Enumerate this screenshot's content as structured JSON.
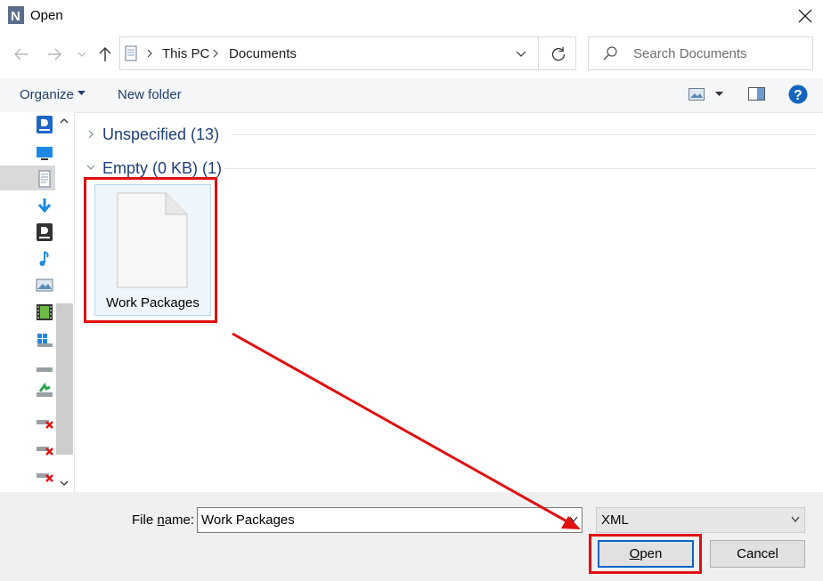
{
  "window": {
    "title": "Open",
    "app_icon": "N"
  },
  "address": {
    "crumbs": [
      "This PC",
      "Documents"
    ]
  },
  "search": {
    "placeholder": "Search Documents"
  },
  "toolbar": {
    "organize": "Organize",
    "new_folder": "New folder",
    "help": "?"
  },
  "groups": [
    {
      "label": "Unspecified (13)",
      "expanded": false
    },
    {
      "label": "Empty (0 KB) (1)",
      "expanded": true
    }
  ],
  "files": [
    {
      "name": "Work Packages"
    }
  ],
  "bottom": {
    "file_name_label_pre": "File ",
    "file_name_label_ul": "n",
    "file_name_label_post": "ame:",
    "file_name_value": "Work Packages",
    "file_type": "XML",
    "open_label": "Open",
    "open_label_ul": "O",
    "open_label_rest": "pen",
    "cancel_label": "Cancel"
  },
  "annotations": {
    "highlight_color": "#e01010"
  },
  "icons": [
    "back-arrow-icon",
    "forward-arrow-icon",
    "recent-dropdown-icon",
    "up-arrow-icon",
    "folder-location-icon",
    "refresh-icon",
    "search-icon",
    "close-icon",
    "view-icon",
    "preview-pane-icon",
    "help-icon",
    "document-file-icon"
  ]
}
